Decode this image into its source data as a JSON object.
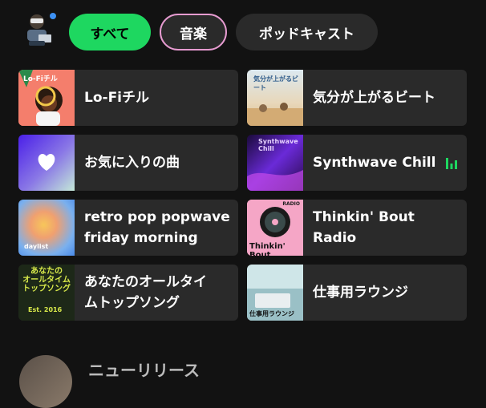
{
  "filters": [
    {
      "label": "すべて",
      "state": "selected"
    },
    {
      "label": "音楽",
      "state": "outlined"
    },
    {
      "label": "ポッドキャスト",
      "state": "default"
    }
  ],
  "cards": [
    {
      "title": "Lo-Fiチル",
      "thumb_text": "Lo-Fiチル"
    },
    {
      "title": "気分が上がるビート",
      "thumb_text": "気分が上がるビート"
    },
    {
      "title": "お気に入りの曲",
      "thumb_icon": "heart-icon"
    },
    {
      "title": "Synthwave Chill",
      "thumb_text": "Synthwave Chill",
      "playing": true
    },
    {
      "title": "retro pop popwave\nfriday morning",
      "thumb_text": "daylist"
    },
    {
      "title": "Thinkin' Bout Radio",
      "thumb_text": "Thinkin' Bout",
      "thumb_badge": "RADIO"
    },
    {
      "title": "あなたのオールタイ\nムトップソング",
      "thumb_text": "あなたの\nオールタイム\nトップソング",
      "thumb_sub": "Est. 2016"
    },
    {
      "title": "仕事用ラウンジ",
      "thumb_text": "仕事用ラウンジ"
    }
  ],
  "section": {
    "title": "ニューリリース"
  },
  "colors": {
    "accent": "#1ed760",
    "card_bg": "#2a2a2a",
    "bg": "#121212",
    "music_border": "#e69bd0"
  }
}
